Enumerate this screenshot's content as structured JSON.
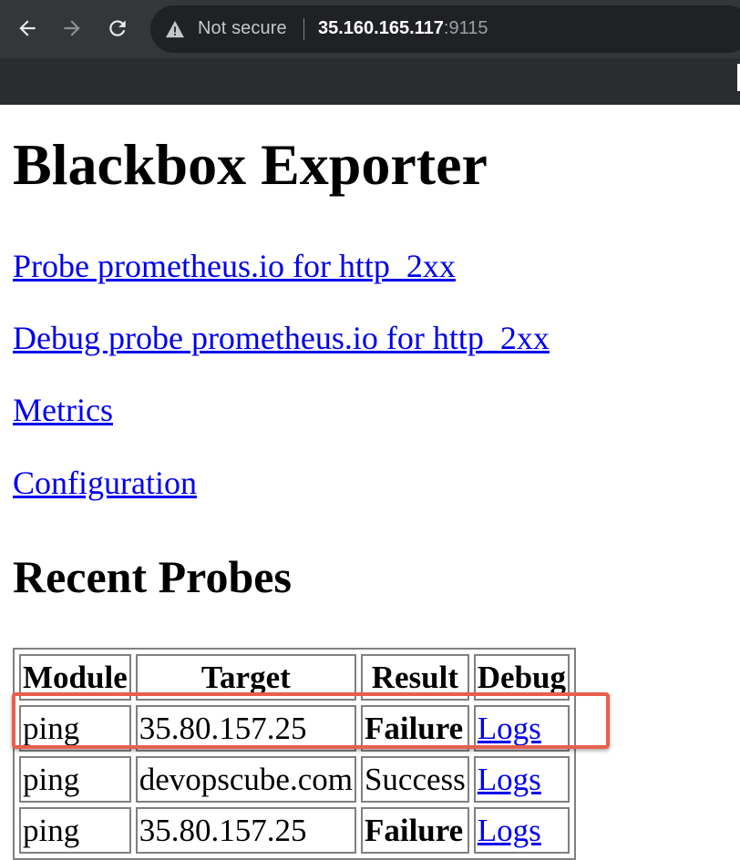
{
  "browser": {
    "security_label": "Not secure",
    "url_host": "35.160.165.117",
    "url_port": ":9115"
  },
  "page": {
    "title": "Blackbox Exporter",
    "links": [
      "Probe prometheus.io for http_2xx",
      "Debug probe prometheus.io for http_2xx",
      "Metrics",
      "Configuration"
    ],
    "recent_heading": "Recent Probes"
  },
  "table": {
    "headers": [
      "Module",
      "Target",
      "Result",
      "Debug"
    ],
    "rows": [
      [
        "ping",
        "35.80.157.25",
        "Failure",
        "Logs"
      ],
      [
        "ping",
        "devopscube.com",
        "Success",
        "Logs"
      ],
      [
        "ping",
        "35.80.157.25",
        "Failure",
        "Logs"
      ]
    ]
  },
  "colors": {
    "link": "#0000ee",
    "highlight": "#e8604c"
  }
}
